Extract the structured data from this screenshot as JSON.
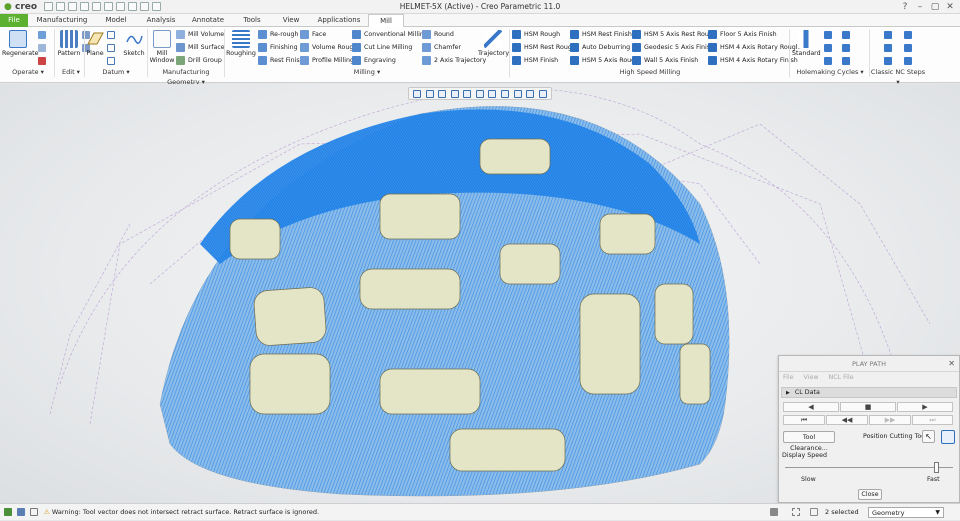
{
  "app": {
    "logo": "creo",
    "window_title": "HELMET-5X (Active) - Creo Parametric 11.0",
    "win_controls": [
      "?",
      "–",
      "▢",
      "✕"
    ]
  },
  "tabs": [
    {
      "label": "File"
    },
    {
      "label": "Manufacturing"
    },
    {
      "label": "Model"
    },
    {
      "label": "Analysis"
    },
    {
      "label": "Annotate"
    },
    {
      "label": "Tools"
    },
    {
      "label": "View"
    },
    {
      "label": "Applications"
    },
    {
      "label": "Mill"
    }
  ],
  "ribbon": {
    "operate": {
      "regenerate": "Regenerate",
      "group": "Operate ▾"
    },
    "edit": {
      "pattern": "Pattern",
      "group": "Edit ▾"
    },
    "datum": {
      "plane": "Plane",
      "sketch": "Sketch",
      "group": "Datum ▾"
    },
    "mfg_geometry": {
      "mill_window": "Mill Window",
      "mill_volume": "Mill Volume",
      "mill_surface": "Mill Surface",
      "drill_group": "Drill Group",
      "group": "Manufacturing Geometry ▾"
    },
    "milling": {
      "roughing": "Roughing",
      "col1": [
        "Re-rough",
        "Finishing",
        "Rest Finish"
      ],
      "col2": [
        "Face",
        "Volume Rough",
        "Profile Milling"
      ],
      "col3": [
        "Conventional Milling",
        "Cut Line Milling",
        "Engraving"
      ],
      "col4": [
        "Round",
        "Chamfer",
        "2 Axis Trajectory"
      ],
      "trajectory": "Trajectory",
      "group": "Milling ▾"
    },
    "hsm": {
      "col1": [
        "HSM Rough",
        "HSM Rest Rough",
        "HSM Finish"
      ],
      "col2": [
        "HSM Rest Finish",
        "Auto Deburring",
        "HSM 5 Axis Rough"
      ],
      "col3": [
        "HSM 5 Axis Rest Rough",
        "Geodesic 5 Axis Finish",
        "Wall 5 Axis Finish"
      ],
      "col4": [
        "Floor 5 Axis Finish",
        "HSM 4 Axis Rotary Rough",
        "HSM 4 Axis Rotary Finish"
      ],
      "group": "High Speed Milling"
    },
    "holemaking": {
      "standard": "Standard",
      "group": "Holemaking Cycles ▾"
    },
    "classic": {
      "group": "Classic NC Steps ▾"
    }
  },
  "play_path": {
    "title": "PLAY PATH",
    "close_glyph": "✕",
    "menu": [
      "File",
      "View",
      "NCL File"
    ],
    "cl_data": "CL Data",
    "cl_arrow": "▶",
    "transport_row1": [
      "◀",
      "■",
      "▶"
    ],
    "transport_row2": [
      "⏮",
      "◀◀",
      "▶▶",
      "⏭"
    ],
    "tool_clearance": "Tool Clearance...",
    "position_cutting_tool": "Position Cutting Tool",
    "display_speed": "Display Speed",
    "slow": "Slow",
    "fast": "Fast",
    "speed_level": 0.9,
    "close": "Close"
  },
  "status": {
    "message": "Warning: Tool vector does not intersect retract surface. Retract surface is ignored.",
    "selected": "2 selected",
    "filter": "Geometry"
  },
  "colors": {
    "file_tab": "#5cb130",
    "toolpath": "#1e7fe6",
    "part": "#e4e4c6",
    "accent_blue": "#2f6fbf"
  }
}
